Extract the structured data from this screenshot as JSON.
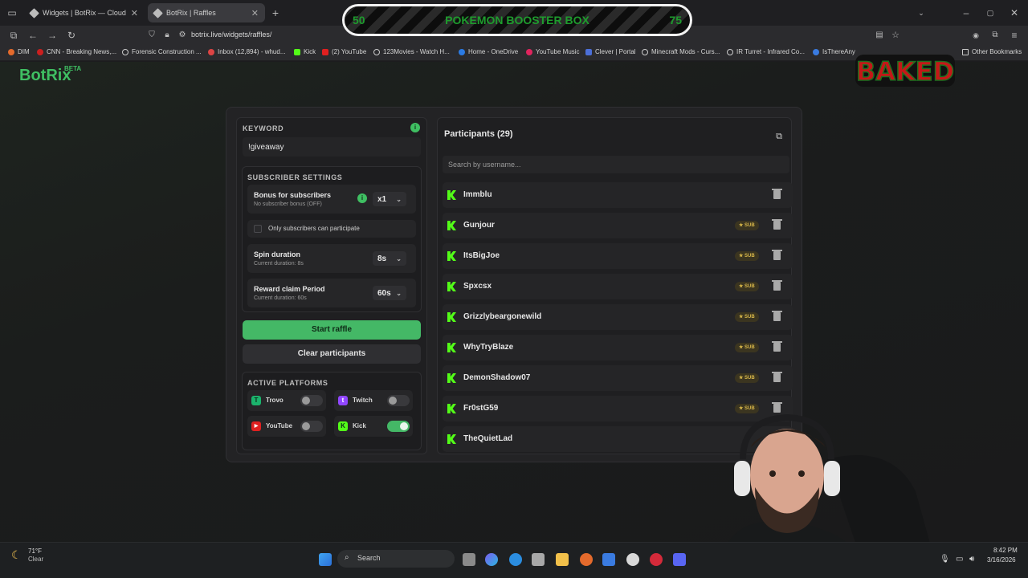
{
  "browser": {
    "tabs": [
      {
        "title": "Widgets | BotRix — Cloud Strea",
        "active": false
      },
      {
        "title": "BotRix | Raffles",
        "active": true
      }
    ],
    "url": "botrix.live/widgets/raffles/",
    "bookmarks": [
      "DIM",
      "CNN - Breaking News,...",
      "Forensic Construction ...",
      "Inbox (12,894) - whud...",
      "Kick",
      "(2) YouTube",
      "123Movies - Watch H...",
      "Home - OneDrive",
      "YouTube Music",
      "Clever | Portal",
      "Minecraft Mods - Curs...",
      "IR Turret - Infrared Co...",
      "IsThereAny"
    ],
    "other_bookmarks": "Other Bookmarks"
  },
  "overlay": {
    "left_value": "50",
    "title": "POKEMON BOOSTER BOX",
    "right_value": "75",
    "logo_text": "BAKED"
  },
  "app": {
    "name": "BotRix",
    "badge": "BETA",
    "accent": "#44b866"
  },
  "settings": {
    "keyword_label": "KEYWORD",
    "keyword_value": "!giveaway",
    "subscriber_label": "SUBSCRIBER SETTINGS",
    "bonus_title": "Bonus for subscribers",
    "bonus_sub": "No subscriber bonus (OFF)",
    "bonus_value": "x1",
    "only_subs": "Only subscribers can participate",
    "spin_title": "Spin duration",
    "spin_sub": "Current duration: 8s",
    "spin_value": "8s",
    "claim_title": "Reward claim Period",
    "claim_sub": "Current duration: 60s",
    "claim_value": "60s",
    "start_label": "Start raffle",
    "clear_label": "Clear participants",
    "platforms_label": "ACTIVE PLATFORMS",
    "platforms": [
      {
        "name": "Trovo",
        "enabled": false
      },
      {
        "name": "Twitch",
        "enabled": false
      },
      {
        "name": "YouTube",
        "enabled": false
      },
      {
        "name": "Kick",
        "enabled": true
      }
    ]
  },
  "participants": {
    "title": "Participants (29)",
    "search_placeholder": "Search by username...",
    "sub_badge": "SUB",
    "list": [
      {
        "name": "Immblu",
        "sub": false
      },
      {
        "name": "Gunjour",
        "sub": true
      },
      {
        "name": "ItsBigJoe",
        "sub": true
      },
      {
        "name": "Spxcsx",
        "sub": true
      },
      {
        "name": "Grizzlybeargonewild",
        "sub": true
      },
      {
        "name": "WhyTryBlaze",
        "sub": true
      },
      {
        "name": "DemonShadow07",
        "sub": true
      },
      {
        "name": "Fr0stG59",
        "sub": true
      },
      {
        "name": "TheQuietLad",
        "sub": false
      }
    ]
  },
  "taskbar": {
    "weather_temp": "71°F",
    "weather_desc": "Clear",
    "search_label": "Search",
    "time": "8:42 PM",
    "date": "3/16/2026"
  }
}
